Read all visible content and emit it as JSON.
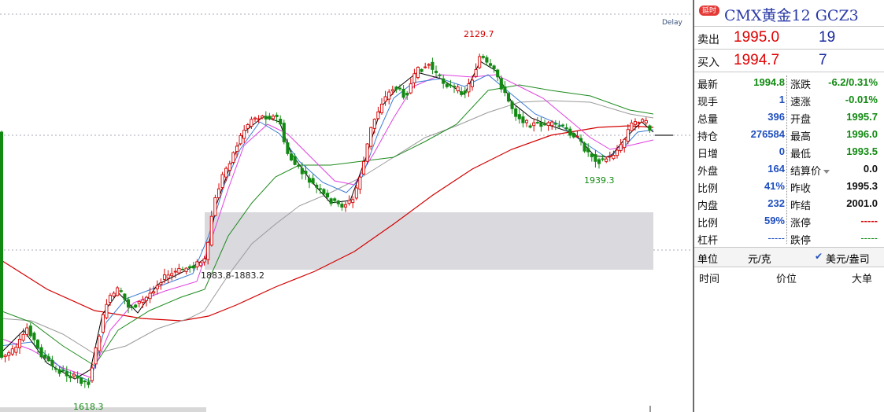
{
  "chart": {
    "delay_label": "Delay",
    "high_label": "2129.7",
    "low_label": "1618.3",
    "swing_low_label": "1939.3",
    "overlap_label": "1883.8-1883.2"
  },
  "colors": {
    "up": "#d40000",
    "down": "#128a12",
    "ma_black": "#000000",
    "ma_blue": "#3a7bd5",
    "ma_magenta": "#e040e0",
    "ma_green": "#1e8a1e",
    "ma_gray": "#9a9a9a",
    "ma_red": "#d40000",
    "zone": "#d9d9de"
  },
  "panel": {
    "badge": "延时",
    "title": "CMX黄金12 GCZ3",
    "sell": {
      "label": "卖出",
      "price": "1995.0",
      "volume": "19"
    },
    "buy": {
      "label": "买入",
      "price": "1994.7",
      "volume": "7"
    },
    "rows": [
      {
        "l1": "最新",
        "v1": "1994.8",
        "c1": "green",
        "l2": "涨跌",
        "v2": "-6.2/0.31%",
        "c2": "green"
      },
      {
        "l1": "现手",
        "v1": "1",
        "c1": "blue",
        "l2": "速涨",
        "v2": "-0.01%",
        "c2": "green"
      },
      {
        "l1": "总量",
        "v1": "396",
        "c1": "blue",
        "l2": "开盘",
        "v2": "1995.7",
        "c2": "green"
      },
      {
        "l1": "持仓",
        "v1": "276584",
        "c1": "blue",
        "l2": "最高",
        "v2": "1996.0",
        "c2": "green"
      },
      {
        "l1": "日增",
        "v1": "0",
        "c1": "blue",
        "l2": "最低",
        "v2": "1993.5",
        "c2": "green"
      },
      {
        "l1": "外盘",
        "v1": "164",
        "c1": "blue",
        "l2": "结算价",
        "v2": "0.0",
        "c2": "black",
        "dropdown": true
      },
      {
        "l1": "比例",
        "v1": "41%",
        "c1": "blue",
        "l2": "昨收",
        "v2": "1995.3",
        "c2": "black"
      },
      {
        "l1": "内盘",
        "v1": "232",
        "c1": "blue",
        "l2": "昨结",
        "v2": "2001.0",
        "c2": "black"
      },
      {
        "l1": "比例",
        "v1": "59%",
        "c1": "blue",
        "l2": "涨停",
        "v2": "-----",
        "c2": "red"
      },
      {
        "l1": "杠杆",
        "v1": "-----",
        "c1": "blue",
        "l2": "跌停",
        "v2": "-----",
        "c2": "green"
      }
    ],
    "unit_label": "单位",
    "unit_value": "元/克",
    "unit_check": "✔",
    "unit_selected": "美元/盎司",
    "table_headers": {
      "time": "时间",
      "price": "价位",
      "size": "大单"
    }
  }
}
